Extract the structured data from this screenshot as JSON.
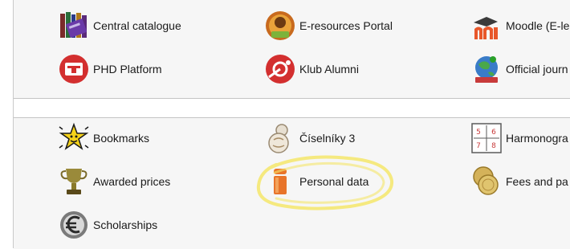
{
  "links_top": [
    {
      "label": "Central catalogue",
      "icon": "books-icon"
    },
    {
      "label": "E-resources Portal",
      "icon": "e-resources-badge-icon"
    },
    {
      "label": "Moodle (E-le",
      "icon": "moodle-logo-icon"
    },
    {
      "label": "PHD Platform",
      "icon": "phd-platform-logo-icon"
    },
    {
      "label": "Klub Alumni",
      "icon": "alumni-logo-icon"
    },
    {
      "label": "Official journ",
      "icon": "globe-journal-icon"
    }
  ],
  "links_bottom": [
    {
      "label": "Bookmarks",
      "icon": "star-icon"
    },
    {
      "label": "Číselníky 3",
      "icon": "badge-3-icon"
    },
    {
      "label": "Harmonogra",
      "icon": "calendar-icon"
    },
    {
      "label": "Awarded prices",
      "icon": "trophy-icon"
    },
    {
      "label": "Personal data",
      "icon": "person-icon"
    },
    {
      "label": "Fees and pa",
      "icon": "coins-icon"
    },
    {
      "label": "Scholarships",
      "icon": "euro-coin-icon"
    }
  ],
  "calendar_icon_digits": [
    "5",
    "6",
    "7",
    "8"
  ],
  "colors": {
    "highlight": "#f5e66a",
    "panel_bg": "#f6f6f6",
    "divider": "#c4c4c4"
  }
}
